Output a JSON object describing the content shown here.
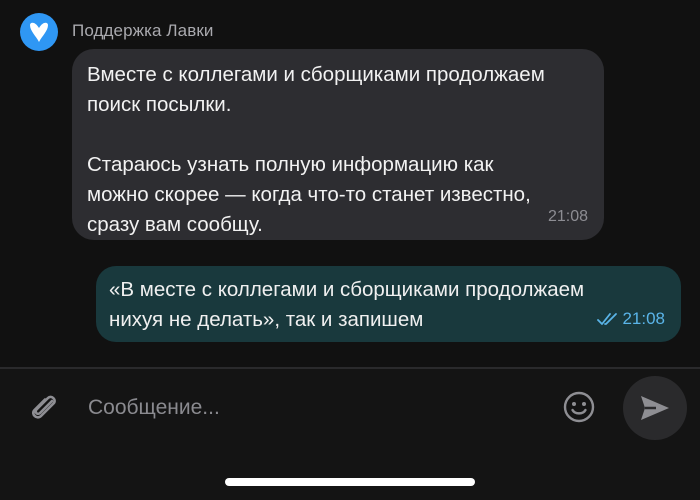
{
  "chat": {
    "sender_name": "Поддержка Лавки",
    "incoming": {
      "line1": "Вместе с коллегами и сборщиками продолжаем",
      "line2": "поиск посылки.",
      "line3": "Стараюсь узнать полную информацию как",
      "line4": "можно скорее — когда что-то станет известно,",
      "line5": "сразу вам сообщу.",
      "time": "21:08"
    },
    "outgoing": {
      "line1": "«В месте с коллегами и сборщиками продолжаем",
      "line2": "нихуя не делать», так и запишем",
      "time": "21:08",
      "status_icon": "double-check-icon"
    }
  },
  "composer": {
    "placeholder": "Сообщение...",
    "attach_icon": "paperclip-icon",
    "emoji_icon": "smiley-icon",
    "send_icon": "send-arrow-icon"
  },
  "colors": {
    "background": "#111111",
    "incoming_bubble": "#2d2d31",
    "outgoing_bubble": "#19393d",
    "avatar": "#2f97f4",
    "read_ticks": "#5ab4e8"
  }
}
